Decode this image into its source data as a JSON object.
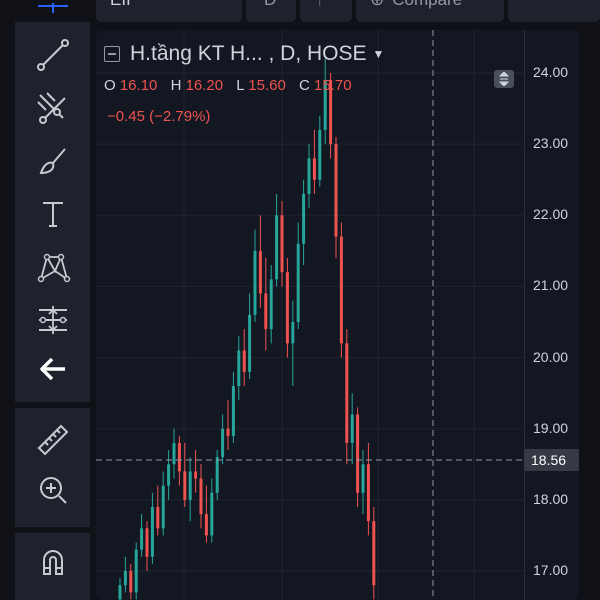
{
  "toolbar": {
    "symbol_label": "EII",
    "interval_label": "D",
    "compare_label": "Compare"
  },
  "sidebar": {
    "tools": [
      "crosshair",
      "trend-line",
      "pitchfork",
      "brush",
      "text",
      "pattern",
      "measure-fib",
      "back-arrow",
      "ruler",
      "zoom-in",
      "magnet"
    ]
  },
  "legend": {
    "title": "H.tầng KT H... , D, HOSE",
    "open_label": "O",
    "open": "16.10",
    "high_label": "H",
    "high": "16.20",
    "low_label": "L",
    "low": "15.60",
    "close_label": "C",
    "close": "15.70",
    "change": "−0.45 (−2.79%)"
  },
  "crosshair_price": "18.56",
  "colors": {
    "up": "#26a69a",
    "down": "#ef5350",
    "background": "#131722"
  },
  "chart_data": {
    "type": "candlestick",
    "y_ticks": [
      "24.00",
      "23.00",
      "22.00",
      "21.00",
      "20.00",
      "19.00",
      "18.00",
      "17.00"
    ],
    "ylim": [
      16.6,
      24.4
    ],
    "candles": [
      [
        16.6,
        16.9,
        16.5,
        16.8
      ],
      [
        16.8,
        17.2,
        16.7,
        17.0
      ],
      [
        17.0,
        17.1,
        16.6,
        16.7
      ],
      [
        16.7,
        17.4,
        16.6,
        17.3
      ],
      [
        17.3,
        17.8,
        17.2,
        17.6
      ],
      [
        17.6,
        17.7,
        17.0,
        17.2
      ],
      [
        17.2,
        18.1,
        17.1,
        17.9
      ],
      [
        17.9,
        18.2,
        17.5,
        17.6
      ],
      [
        17.6,
        18.4,
        17.5,
        18.2
      ],
      [
        18.2,
        18.7,
        18.0,
        18.5
      ],
      [
        18.5,
        19.0,
        18.3,
        18.8
      ],
      [
        18.8,
        18.9,
        18.2,
        18.4
      ],
      [
        18.4,
        18.8,
        17.9,
        18.0
      ],
      [
        18.0,
        18.6,
        17.7,
        18.4
      ],
      [
        18.4,
        18.7,
        18.1,
        18.3
      ],
      [
        18.3,
        18.5,
        17.6,
        17.8
      ],
      [
        17.8,
        18.2,
        17.4,
        17.5
      ],
      [
        17.5,
        18.3,
        17.4,
        18.1
      ],
      [
        18.1,
        18.7,
        18.0,
        18.6
      ],
      [
        18.6,
        19.2,
        18.5,
        19.0
      ],
      [
        19.0,
        19.4,
        18.7,
        18.9
      ],
      [
        18.9,
        19.8,
        18.8,
        19.6
      ],
      [
        19.6,
        20.3,
        19.4,
        20.1
      ],
      [
        20.1,
        20.4,
        19.6,
        19.8
      ],
      [
        19.8,
        20.9,
        19.7,
        20.6
      ],
      [
        20.6,
        21.8,
        20.5,
        21.5
      ],
      [
        21.5,
        22.0,
        20.7,
        20.9
      ],
      [
        20.9,
        21.4,
        20.1,
        20.4
      ],
      [
        20.4,
        21.3,
        20.2,
        21.1
      ],
      [
        21.1,
        22.3,
        21.0,
        22.0
      ],
      [
        22.0,
        22.2,
        21.0,
        21.2
      ],
      [
        21.2,
        21.4,
        20.0,
        20.2
      ],
      [
        20.2,
        20.8,
        19.6,
        20.5
      ],
      [
        20.5,
        21.9,
        20.4,
        21.6
      ],
      [
        21.6,
        22.5,
        21.3,
        22.3
      ],
      [
        22.3,
        23.0,
        22.1,
        22.8
      ],
      [
        22.8,
        23.2,
        22.3,
        22.5
      ],
      [
        22.5,
        23.4,
        22.4,
        23.2
      ],
      [
        23.2,
        24.2,
        23.0,
        23.9
      ],
      [
        23.9,
        24.0,
        22.8,
        23.0
      ],
      [
        23.0,
        23.1,
        21.4,
        21.7
      ],
      [
        21.7,
        21.9,
        20.0,
        20.2
      ],
      [
        20.2,
        20.4,
        18.5,
        18.8
      ],
      [
        18.8,
        19.5,
        18.5,
        19.2
      ],
      [
        19.2,
        19.3,
        17.9,
        18.1
      ],
      [
        18.1,
        18.7,
        17.8,
        18.5
      ],
      [
        18.5,
        18.8,
        17.5,
        17.7
      ],
      [
        17.7,
        17.9,
        16.6,
        16.8
      ]
    ]
  }
}
